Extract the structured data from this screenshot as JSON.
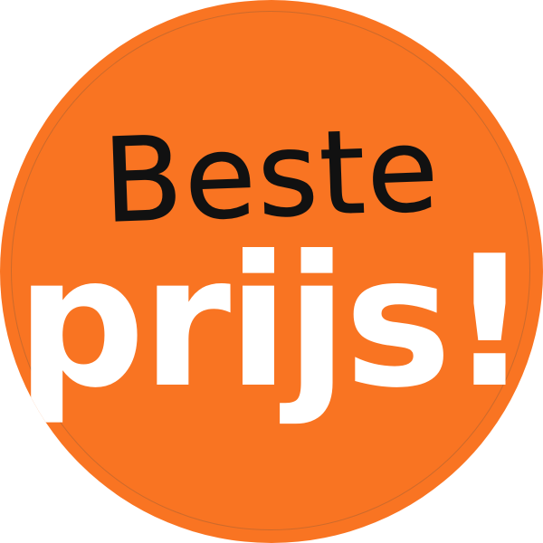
{
  "badge": {
    "headline": "Beste",
    "subline": "prijs!",
    "background_color": "#f97422",
    "headline_color": "#111111",
    "subline_color": "#ffffff"
  }
}
